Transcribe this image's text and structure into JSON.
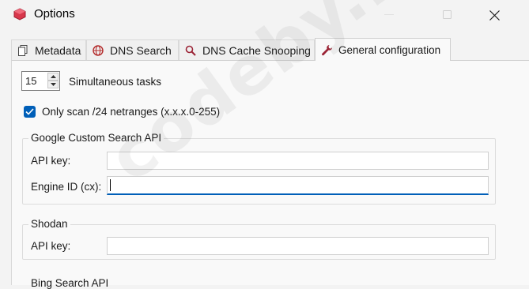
{
  "window": {
    "title": "Options"
  },
  "tabs": [
    {
      "label": "Metadata",
      "icon": "document-icon"
    },
    {
      "label": "DNS Search",
      "icon": "globe-icon"
    },
    {
      "label": "DNS Cache Snooping",
      "icon": "magnifier-icon"
    },
    {
      "label": "General configuration",
      "icon": "wrench-icon",
      "active": true
    }
  ],
  "general": {
    "simultaneous_value": "15",
    "simultaneous_label": "Simultaneous tasks",
    "only_scan_label": "Only scan /24 netranges (x.x.x.0-255)",
    "only_scan_checked": true
  },
  "google": {
    "title": "Google Custom Search API",
    "api_key_label": "API key:",
    "api_key_value": "",
    "engine_label": "Engine ID (cx):",
    "engine_value": ""
  },
  "shodan": {
    "title": "Shodan",
    "api_key_label": "API key:",
    "api_key_value": ""
  },
  "bing": {
    "title": "Bing Search API"
  },
  "watermark": "codeby.net",
  "colors": {
    "accent": "#005fb8",
    "window_bg": "#f3f3f3",
    "panel_bg": "#f9f9f9"
  }
}
